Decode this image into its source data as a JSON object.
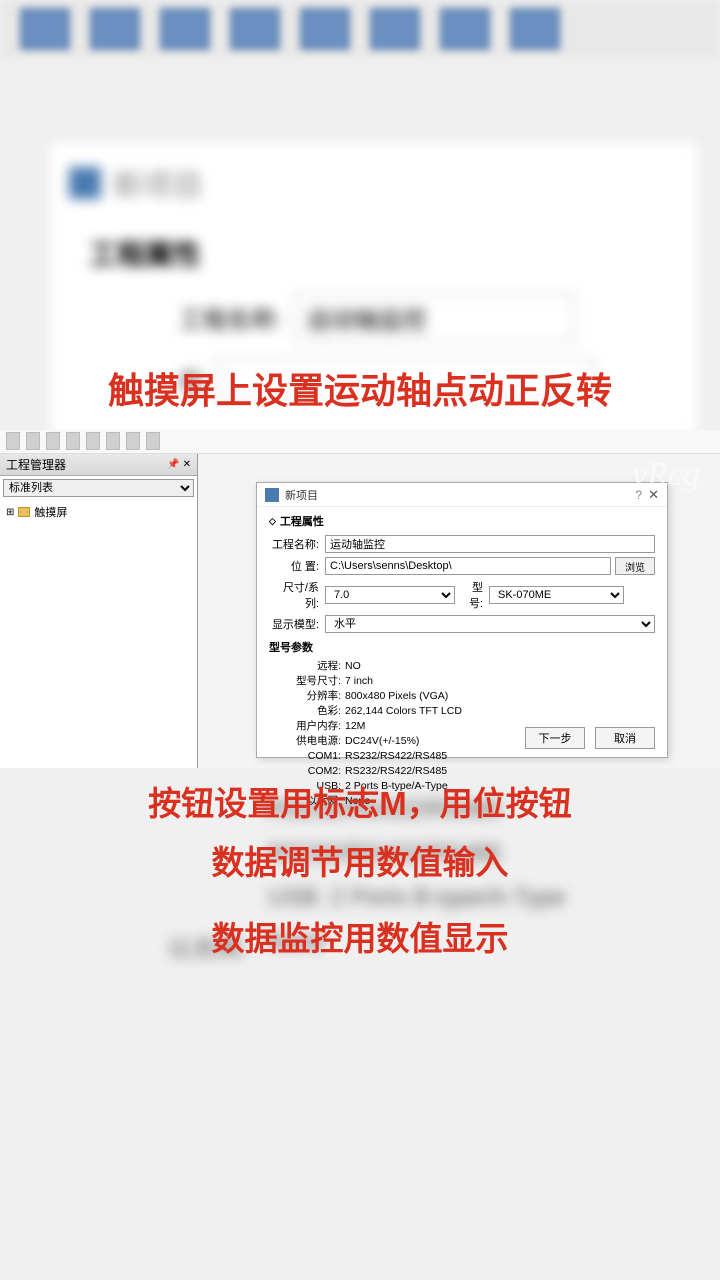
{
  "captions": {
    "line1": "触摸屏上设置运动轴点动正反转",
    "line2": "按钮设置用标志M，用位按钮",
    "line3": "数据调节用数值输入",
    "line4": "数据监控用数值显示"
  },
  "watermark": "vRcg",
  "bg_dialog": {
    "title": "新项目",
    "section": "工程属性",
    "name_label": "工程名称:",
    "name_value": "运动轴监控"
  },
  "blurred_specs": {
    "row1": "RS232/RS422/RS485",
    "row2": "RS232/RS422/RS485",
    "row3": "USB:  2 Ports B-type/A-Type",
    "row4_label": "以太网:",
    "row4_value": "None"
  },
  "app": {
    "tree_panel_title": "工程管理器",
    "tree_dropdown": "标准列表",
    "tree_item": "触摸屏"
  },
  "dialog": {
    "title": "新项目",
    "section": "工程属性",
    "rows": {
      "name_label": "工程名称:",
      "name_value": "运动轴监控",
      "loc_label": "位    置:",
      "loc_value": "C:\\Users\\senns\\Desktop\\",
      "browse": "浏览",
      "size_label": "尺寸/系列:",
      "size_value": "7.0",
      "model_label": "型    号:",
      "model_value": "SK-070ME",
      "disp_label": "显示模型:",
      "disp_value": "水平"
    },
    "spec_header": "型号参数",
    "specs": [
      {
        "label": "远程:",
        "value": "NO"
      },
      {
        "label": "型号尺寸:",
        "value": "7 inch"
      },
      {
        "label": "分辨率:",
        "value": "800x480 Pixels (VGA)"
      },
      {
        "label": "色彩:",
        "value": "262,144 Colors TFT LCD"
      },
      {
        "label": "用户内存:",
        "value": "12M"
      },
      {
        "label": "供电电源:",
        "value": "DC24V(+/-15%)"
      },
      {
        "label": "COM1:",
        "value": "RS232/RS422/RS485"
      },
      {
        "label": "COM2:",
        "value": "RS232/RS422/RS485"
      },
      {
        "label": "USB:",
        "value": "2 Ports B-type/A-Type"
      },
      {
        "label": "以太网:",
        "value": "None"
      }
    ],
    "buttons": {
      "next": "下一步",
      "cancel": "取消"
    }
  }
}
